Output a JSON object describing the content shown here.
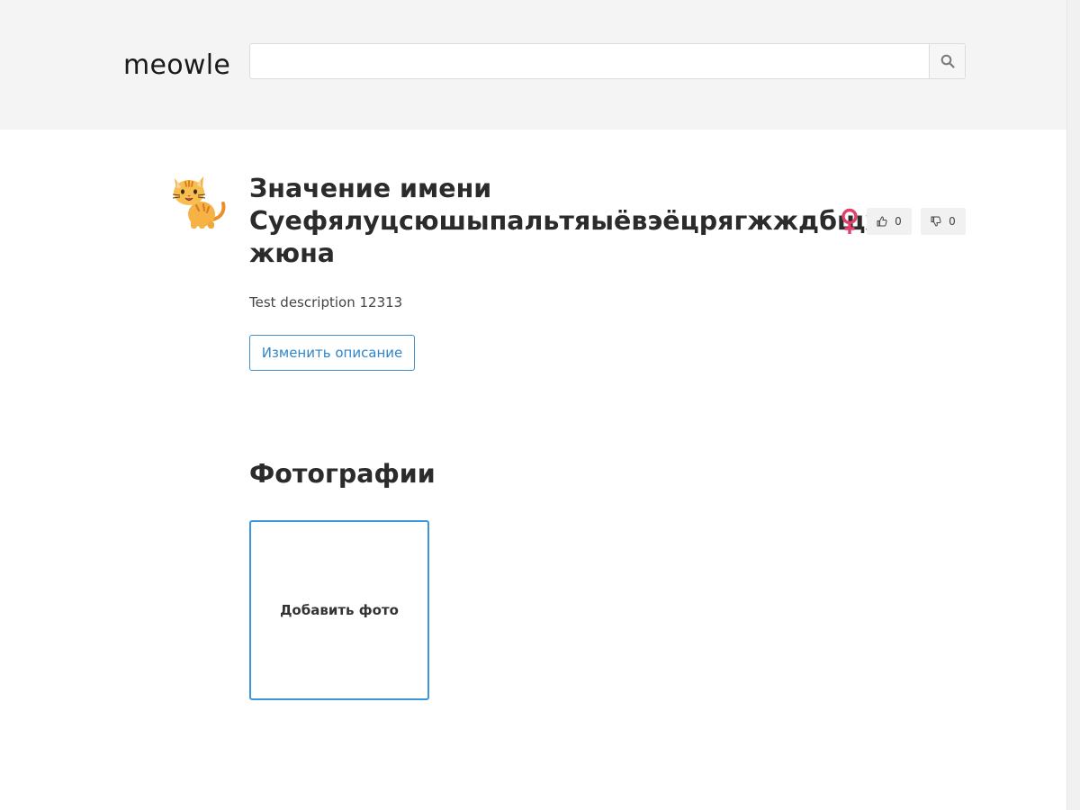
{
  "header": {
    "logo": "meowle",
    "search": {
      "value": "",
      "placeholder": "",
      "button_icon": "search-icon"
    }
  },
  "cat": {
    "avatar_icon": "cat-emoji-icon",
    "title_lines": [
      "Значение имени",
      "Суефялуцсюшыпальтяыёвэёцрягжждбщх",
      "жюна"
    ],
    "gender_icon": "female-sign-icon",
    "gender_color": "#e0416b",
    "likes": "0",
    "dislikes": "0",
    "description": "Test description 12313",
    "edit_button_label": "Изменить описание"
  },
  "photos": {
    "heading": "Фотографии",
    "add_photo_label": "Добавить фото"
  },
  "colors": {
    "header_bg": "#f4f4f4",
    "accent": "#3d8fd1"
  }
}
